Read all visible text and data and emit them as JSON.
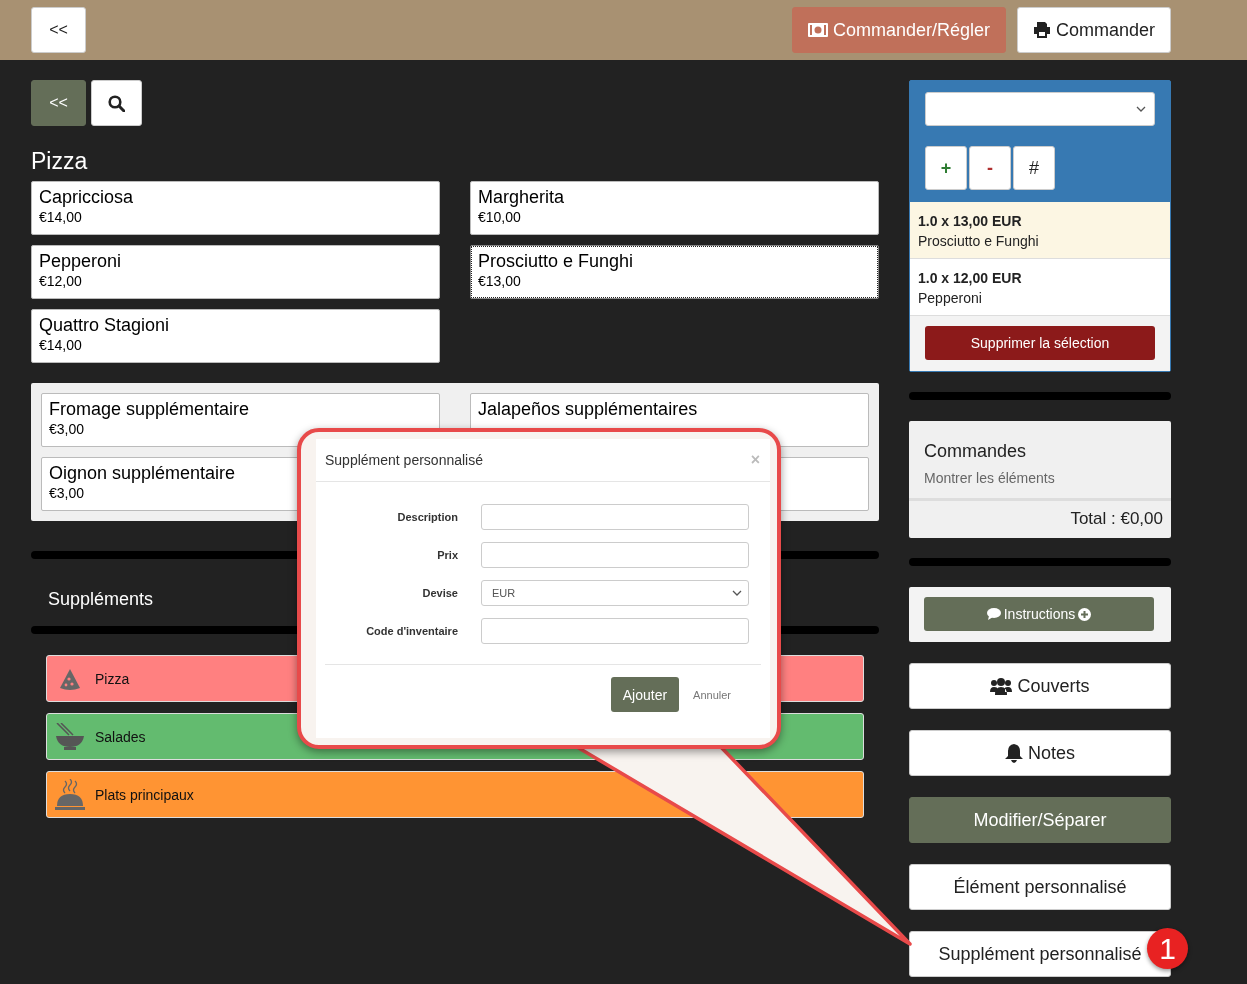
{
  "top_bar": {
    "back": "<<",
    "buttons": [
      {
        "label": "Commander/Régler",
        "kind": "pay"
      },
      {
        "label": "Commander",
        "kind": "print"
      }
    ]
  },
  "menu": {
    "back": "<<",
    "category_title": "Pizza",
    "products": [
      {
        "name": "Capricciosa",
        "price": "€14,00",
        "selected": false
      },
      {
        "name": "Margherita",
        "price": "€10,00",
        "selected": false
      },
      {
        "name": "Pepperoni",
        "price": "€12,00",
        "selected": false
      },
      {
        "name": "Prosciutto e Funghi",
        "price": "€13,00",
        "selected": true
      },
      {
        "name": "Quattro Stagioni",
        "price": "€14,00",
        "selected": false
      }
    ],
    "supplements": [
      {
        "name": "Fromage supplémentaire",
        "price": "€3,00"
      },
      {
        "name": "Jalapeños supplémentaires"
      },
      {
        "name": "Oignon supplémentaire",
        "price": "€3,00"
      },
      {
        "covered": true
      }
    ],
    "supplements_title": "Suppléments",
    "categories": [
      {
        "label": "Pizza",
        "color": "#ff8080",
        "kind": "pizza"
      },
      {
        "label": "Salades",
        "color": "#63bb6f",
        "kind": "salad"
      },
      {
        "label": "Plats principaux",
        "color": "#ff9433",
        "kind": "main"
      }
    ]
  },
  "order": {
    "qty_buttons": [
      {
        "label": "+",
        "kind": "add"
      },
      {
        "label": "-",
        "kind": "remove"
      },
      {
        "label": "#",
        "kind": "number"
      }
    ],
    "lines": [
      {
        "qty_price": "1.0 x 13,00 EUR",
        "name": "Prosciutto e Funghi",
        "selected": true
      },
      {
        "qty_price": "1.0 x 12,00 EUR",
        "name": "Pepperoni",
        "selected": false
      }
    ],
    "delete": "Supprimer la sélection"
  },
  "commandes": {
    "title": "Commandes",
    "link": "Montrer les éléments",
    "total": "Total : €0,00"
  },
  "actions": [
    {
      "label": "Instructions",
      "kind": "instructions"
    },
    {
      "label": "Couverts",
      "kind": "covers"
    },
    {
      "label": "Notes",
      "kind": "notes"
    },
    {
      "label": "Modifier/Séparer",
      "kind": "edit"
    },
    {
      "label": "Élément personnalisé",
      "kind": "plain"
    },
    {
      "label": "Supplément personnalisé",
      "kind": "plain"
    }
  ],
  "dialog": {
    "title": "Supplément personnalisé",
    "close": "×",
    "fields": [
      {
        "label": "Description",
        "kind": "text"
      },
      {
        "label": "Prix",
        "kind": "text"
      },
      {
        "label": "Devise",
        "kind": "select",
        "value": "EUR"
      },
      {
        "label": "Code d'inventaire",
        "kind": "text"
      }
    ],
    "submit": "Ajouter",
    "cancel": "Annuler"
  },
  "callout_badge": "1"
}
